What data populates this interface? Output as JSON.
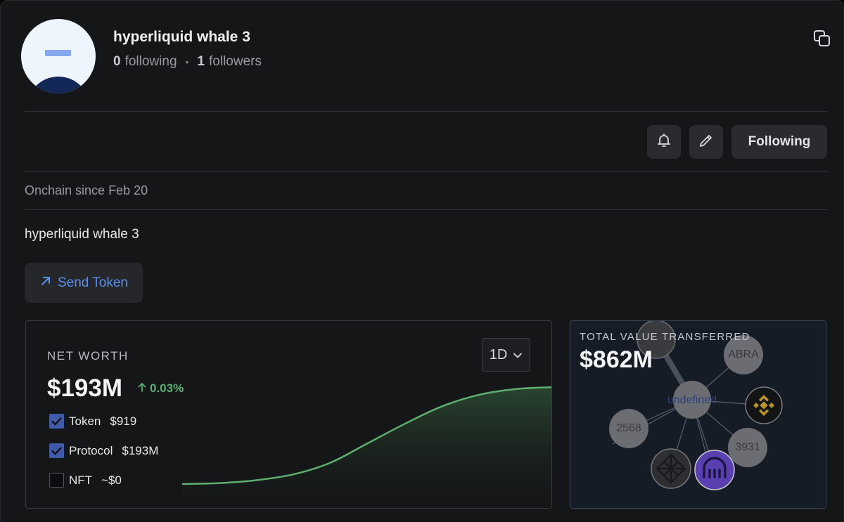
{
  "profile": {
    "name": "hyperliquid whale 3",
    "following_count": "0",
    "following_label": "following",
    "followers_count": "1",
    "followers_label": "followers",
    "onchain_since": "Onchain since Feb 20",
    "bio": "hyperliquid whale 3"
  },
  "actions": {
    "following_label": "Following",
    "send_token_label": "Send Token"
  },
  "net_worth": {
    "label": "NET WORTH",
    "value": "$193M",
    "change": "0.03%",
    "change_color": "#59b073",
    "range": "1D",
    "items": [
      {
        "label": "Token",
        "amount": "$919",
        "checked": true
      },
      {
        "label": "Protocol",
        "amount": "$193M",
        "checked": true
      },
      {
        "label": "NFT",
        "amount": "~$0",
        "checked": false
      }
    ]
  },
  "chart_data": {
    "type": "area",
    "x": [
      0,
      1,
      2,
      3,
      4,
      5,
      6,
      7,
      8,
      9,
      10
    ],
    "values": [
      0,
      0.01,
      0.04,
      0.1,
      0.22,
      0.42,
      0.62,
      0.8,
      0.92,
      0.98,
      1.0
    ],
    "title": "",
    "xlabel": "",
    "ylabel": "",
    "line_color": "#5fb06e"
  },
  "total_value_transferred": {
    "label": "TOTAL VALUE TRANSFERRED",
    "value": "$862M",
    "nodes": {
      "center": "undefined",
      "abra": "ABRA",
      "n2568": "2568",
      "n3931": "3931"
    }
  }
}
